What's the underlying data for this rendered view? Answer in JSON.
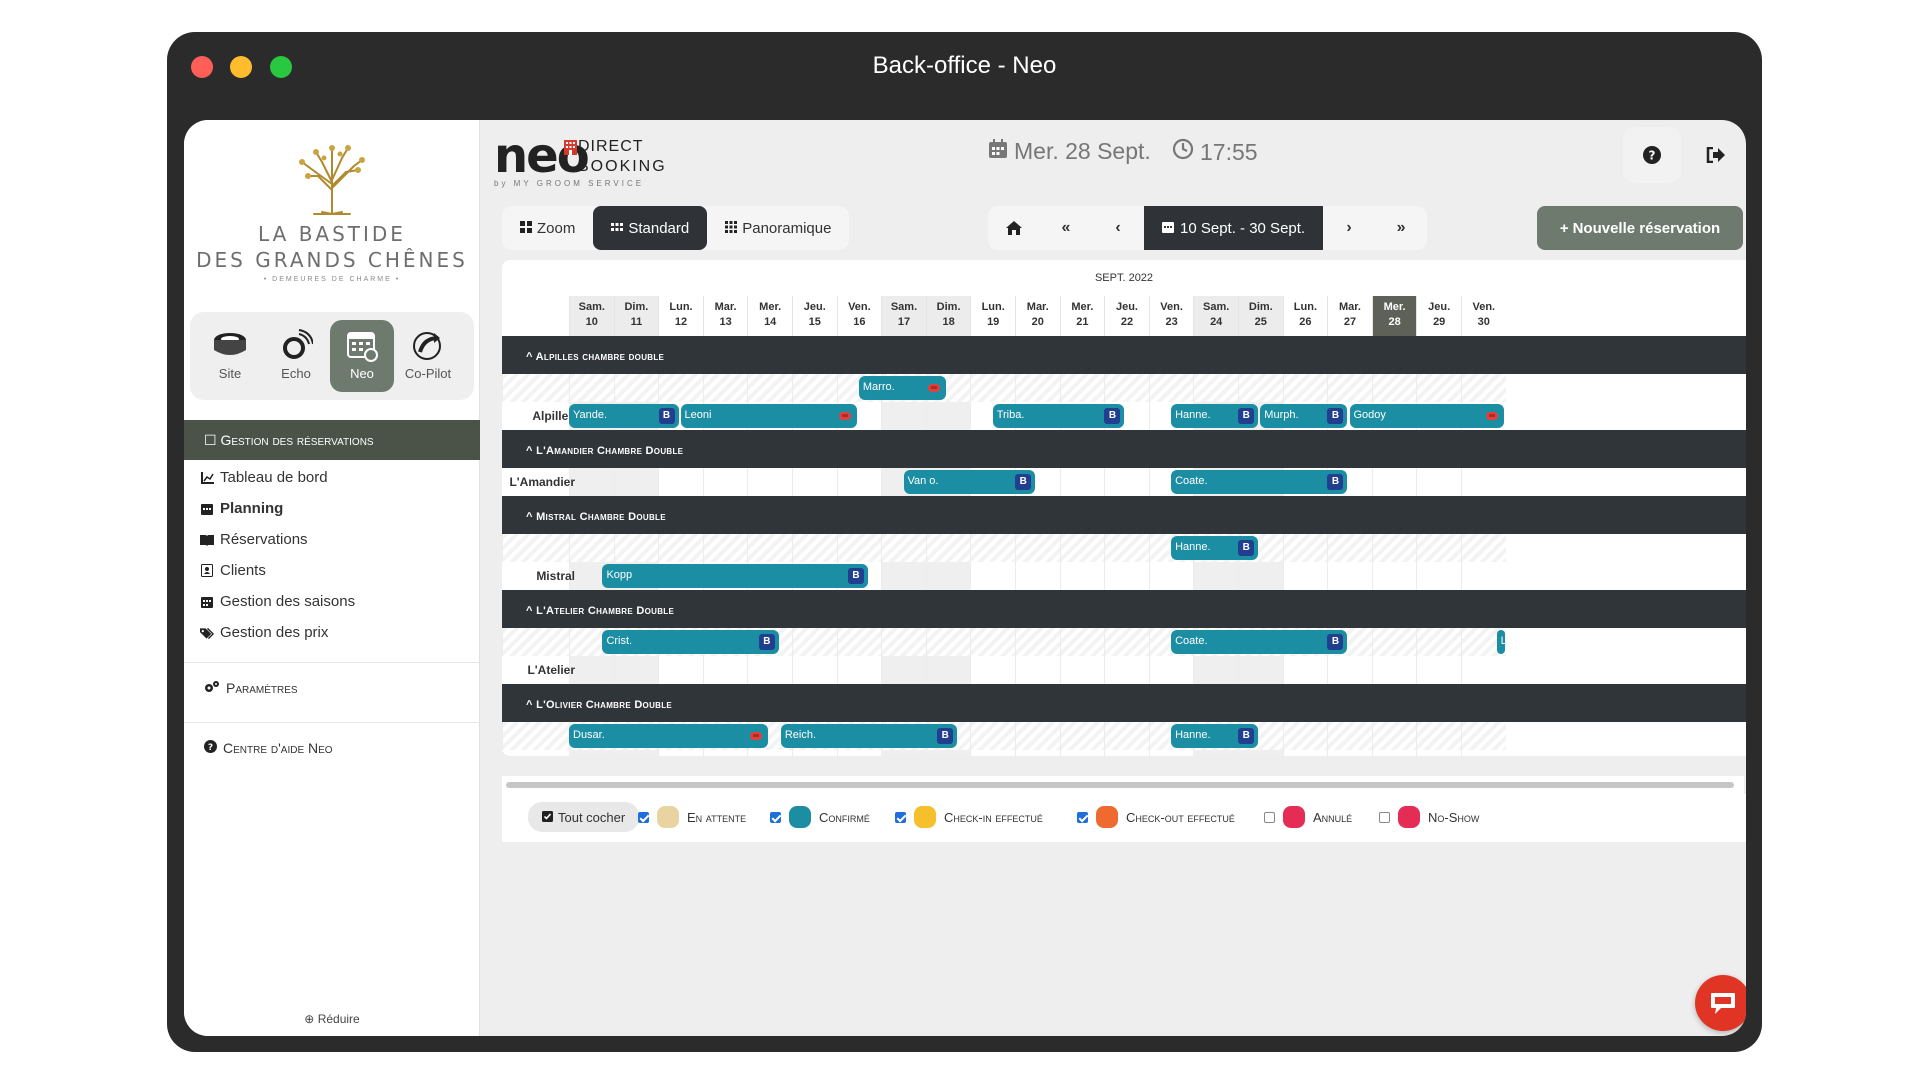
{
  "window": {
    "title": "Back-office - Neo"
  },
  "sidebar": {
    "logo": {
      "line1": "LA BASTIDE",
      "line2": "DES GRANDS CHÊNES",
      "line3": "• DEMEURES DE CHARME •"
    },
    "apps": [
      {
        "label": "Site"
      },
      {
        "label": "Echo"
      },
      {
        "label": "Neo"
      },
      {
        "label": "Co-Pilot"
      }
    ],
    "section_title": "Gestion des réservations",
    "items": [
      {
        "label": "Tableau de bord"
      },
      {
        "label": "Planning"
      },
      {
        "label": "Réservations"
      },
      {
        "label": "Clients"
      },
      {
        "label": "Gestion des saisons"
      },
      {
        "label": "Gestion des prix"
      }
    ],
    "settings": "Paramètres",
    "help": "Centre d'aide Neo",
    "reduce": "Réduire"
  },
  "header": {
    "brand": {
      "word": "neo",
      "direct": "DIRECT",
      "booking": "BOOKING",
      "by": "by MY GROOM SERVICE"
    },
    "date": "Mer. 28 Sept.",
    "time": "17:55"
  },
  "toolbar": {
    "views": [
      {
        "label": "Zoom"
      },
      {
        "label": "Standard"
      },
      {
        "label": "Panoramique"
      }
    ],
    "range": "10 Sept. - 30 Sept.",
    "new_reservation": "Nouvelle réservation"
  },
  "planning": {
    "month": "SEPT. 2022",
    "days": [
      {
        "dow": "Sam.",
        "num": "10",
        "weekend": true
      },
      {
        "dow": "Dim.",
        "num": "11",
        "weekend": true
      },
      {
        "dow": "Lun.",
        "num": "12"
      },
      {
        "dow": "Mar.",
        "num": "13"
      },
      {
        "dow": "Mer.",
        "num": "14"
      },
      {
        "dow": "Jeu.",
        "num": "15"
      },
      {
        "dow": "Ven.",
        "num": "16"
      },
      {
        "dow": "Sam.",
        "num": "17",
        "weekend": true
      },
      {
        "dow": "Dim.",
        "num": "18",
        "weekend": true
      },
      {
        "dow": "Lun.",
        "num": "19"
      },
      {
        "dow": "Mar.",
        "num": "20"
      },
      {
        "dow": "Mer.",
        "num": "21"
      },
      {
        "dow": "Jeu.",
        "num": "22"
      },
      {
        "dow": "Ven.",
        "num": "23"
      },
      {
        "dow": "Sam.",
        "num": "24",
        "weekend": true
      },
      {
        "dow": "Dim.",
        "num": "25",
        "weekend": true
      },
      {
        "dow": "Lun.",
        "num": "26"
      },
      {
        "dow": "Mar.",
        "num": "27"
      },
      {
        "dow": "Mer.",
        "num": "28",
        "today": true
      },
      {
        "dow": "Jeu.",
        "num": "29"
      },
      {
        "dow": "Ven.",
        "num": "30"
      }
    ],
    "categories": [
      {
        "title": "^ Alpilles chambre double",
        "rows": [
          {
            "room": "",
            "bookings": [
              {
                "name": "Marro.",
                "start": 6.5,
                "end": 8.5,
                "badge": "heart"
              }
            ]
          },
          {
            "room": "Alpilles",
            "bookings": [
              {
                "name": "Yande.",
                "start": 0,
                "end": 2.5,
                "badge": "B"
              },
              {
                "name": "Leoni",
                "start": 2.5,
                "end": 6.5,
                "badge": "heart"
              },
              {
                "name": "Triba.",
                "start": 9.5,
                "end": 12.5,
                "badge": "B"
              },
              {
                "name": "Hanne.",
                "start": 13.5,
                "end": 15.5,
                "badge": "B"
              },
              {
                "name": "Murph.",
                "start": 15.5,
                "end": 17.5,
                "badge": "B"
              },
              {
                "name": "Godoy",
                "start": 17.5,
                "end": 21,
                "badge": "heart"
              }
            ]
          }
        ]
      },
      {
        "title": "^ L'Amandier Chambre Double",
        "rows": [
          {
            "room": "L'Amandier",
            "bookings": [
              {
                "name": "Van o.",
                "start": 7.5,
                "end": 10.5,
                "badge": "B"
              },
              {
                "name": "Coate.",
                "start": 13.5,
                "end": 17.5,
                "badge": "B"
              }
            ]
          }
        ]
      },
      {
        "title": "^ Mistral Chambre Double",
        "rows": [
          {
            "room": "",
            "bookings": [
              {
                "name": "Hanne.",
                "start": 13.5,
                "end": 15.5,
                "badge": "B"
              }
            ]
          },
          {
            "room": "Mistral",
            "bookings": [
              {
                "name": "Kopp",
                "start": 0.75,
                "end": 6.75,
                "badge": "B"
              }
            ]
          }
        ]
      },
      {
        "title": "^ L'Atelier Chambre Double",
        "rows": [
          {
            "room": "",
            "bookings": [
              {
                "name": "Crist.",
                "start": 0.75,
                "end": 4.75,
                "badge": "B"
              },
              {
                "name": "Coate.",
                "start": 13.5,
                "end": 17.5,
                "badge": "B"
              },
              {
                "name": "L",
                "start": 20.8,
                "end": 21,
                "badge": ""
              }
            ]
          },
          {
            "room": "L'Atelier",
            "bookings": []
          }
        ]
      },
      {
        "title": "^ L'Olivier Chambre Double",
        "rows": [
          {
            "room": "",
            "bookings": [
              {
                "name": "Dusar.",
                "start": 0,
                "end": 4.5,
                "badge": "heart"
              },
              {
                "name": "Reich.",
                "start": 4.75,
                "end": 8.75,
                "badge": "B"
              },
              {
                "name": "Hanne.",
                "start": 13.5,
                "end": 15.5,
                "badge": "B"
              }
            ]
          },
          {
            "room": "L'Olivier",
            "bookings": []
          }
        ]
      }
    ]
  },
  "legend": {
    "check_all": "Tout cocher",
    "items": [
      {
        "label": "En attente",
        "color": "#e8d3a1",
        "checked": true
      },
      {
        "label": "Confirmé",
        "color": "#1b8ea3",
        "checked": true
      },
      {
        "label": "Check-in effectué",
        "color": "#f5c02b",
        "checked": true
      },
      {
        "label": "Check-out effectué",
        "color": "#ef6a2e",
        "checked": true
      },
      {
        "label": "Annulé",
        "color": "#e52c55",
        "checked": false
      },
      {
        "label": "No-Show",
        "color": "#e52c55",
        "checked": false
      }
    ]
  },
  "colors": {
    "accent": "#6f7a6f",
    "booking": "#1b8ea3",
    "dark": "#30353a",
    "chat": "#e03524"
  }
}
